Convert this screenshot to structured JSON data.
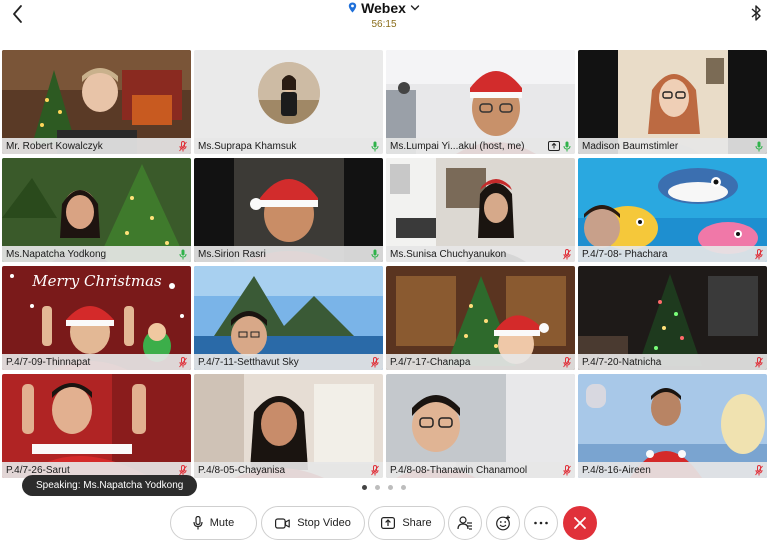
{
  "app": {
    "title": "Webex",
    "timer": "56:15"
  },
  "tiles": [
    {
      "name": "Mr. Robert Kowalczyk",
      "mic": "muted"
    },
    {
      "name": "Ms.Suprapa Khamsuk",
      "mic": "on"
    },
    {
      "name": "Ms.Lumpai Yi...akul (host, me)",
      "mic": "on"
    },
    {
      "name": "Madison Baumstimler",
      "mic": "on"
    },
    {
      "name": "Ms.Napatcha Yodkong",
      "mic": "on"
    },
    {
      "name": "Ms.Sirion Rasri",
      "mic": "on"
    },
    {
      "name": "Ms.Sunisa Chuchyanukon",
      "mic": "muted"
    },
    {
      "name": "P.4/7-08- Phachara",
      "mic": "muted"
    },
    {
      "name": "P.4/7-09-Thinnapat",
      "mic": "muted"
    },
    {
      "name": "P.4/7-11-Setthavut Sky",
      "mic": "muted"
    },
    {
      "name": "P.4/7-17-Chanapa",
      "mic": "muted"
    },
    {
      "name": "P.4/7-20-Natnicha",
      "mic": "muted"
    },
    {
      "name": "P.4/7-26-Sarut",
      "mic": "muted"
    },
    {
      "name": "P.4/8-05-Chayanisa",
      "mic": "muted"
    },
    {
      "name": "P.4/8-08-Thanawin Chanamool",
      "mic": "muted"
    },
    {
      "name": "P.4/8-16-Aireen",
      "mic": "muted"
    }
  ],
  "tile_art": {
    "overlay_text": "Merry Christmas"
  },
  "speaking": "Speaking: Ms.Napatcha Yodkong",
  "pagination": {
    "pages": 4,
    "current": 1
  },
  "controls": {
    "mute": "Mute",
    "stop_video": "Stop Video",
    "share": "Share"
  },
  "colors": {
    "active_outline": "#3fb6a8",
    "mic_on": "#2fb24a",
    "mic_muted": "#e0313a",
    "end_call": "#e0313a"
  }
}
